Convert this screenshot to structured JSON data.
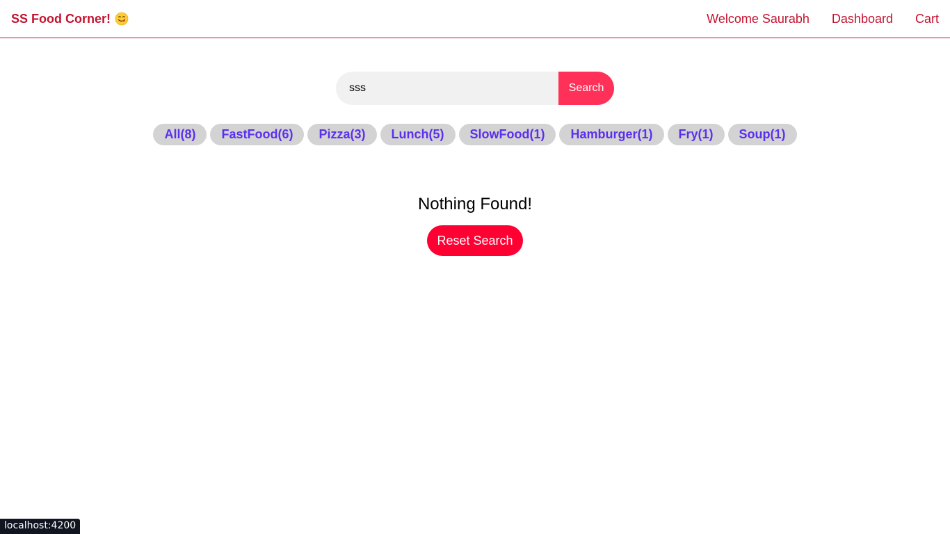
{
  "header": {
    "logo_text": "SS Food Corner!",
    "logo_icon": "face-savoring-food-emoji",
    "nav": [
      {
        "label": "Welcome Saurabh"
      },
      {
        "label": "Dashboard"
      },
      {
        "label": "Cart"
      }
    ]
  },
  "search": {
    "value": "sss",
    "button_label": "Search"
  },
  "tags": [
    {
      "label": "All(8)"
    },
    {
      "label": "FastFood(6)"
    },
    {
      "label": "Pizza(3)"
    },
    {
      "label": "Lunch(5)"
    },
    {
      "label": "SlowFood(1)"
    },
    {
      "label": "Hamburger(1)"
    },
    {
      "label": "Fry(1)"
    },
    {
      "label": "Soup(1)"
    }
  ],
  "not_found": {
    "message": "Nothing Found!",
    "reset_label": "Reset Search"
  },
  "status_bar": {
    "url": "localhost:4200"
  },
  "colors": {
    "brand": "#c4122f",
    "search_button": "#ff3158",
    "reset_button": "#ff0033",
    "tag_text": "#5b2ff0",
    "tag_bg": "#d3d3d3"
  }
}
